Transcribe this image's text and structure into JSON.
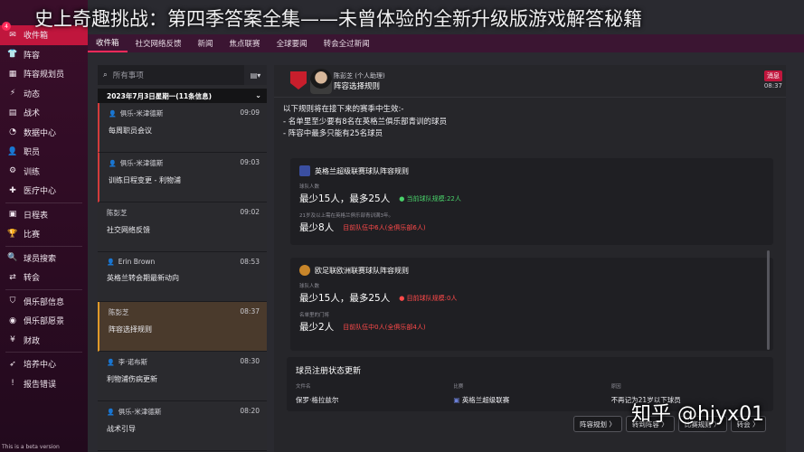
{
  "title_overlay": "史上奇趣挑战：第四季答案全集——未曾体验的全新升级版游戏解答秘籍",
  "watermark": "知乎 @hjyx01",
  "beta": "This is a beta version",
  "sidebar": {
    "notif_count": "4",
    "items": [
      {
        "label": "收件箱",
        "icon": "✉"
      },
      {
        "label": "阵容",
        "icon": "👕"
      },
      {
        "label": "阵容规划员",
        "icon": "▦"
      },
      {
        "label": "动态",
        "icon": "⚡"
      },
      {
        "label": "战术",
        "icon": "▤"
      },
      {
        "label": "数据中心",
        "icon": "◔"
      },
      {
        "label": "职员",
        "icon": "👤"
      },
      {
        "label": "训练",
        "icon": "⚙"
      },
      {
        "label": "医疗中心",
        "icon": "✚"
      },
      {
        "label": "日程表",
        "icon": "▣"
      },
      {
        "label": "比赛",
        "icon": "🏆"
      },
      {
        "label": "球员搜索",
        "icon": "🔍"
      },
      {
        "label": "转会",
        "icon": "⇄"
      },
      {
        "label": "俱乐部信息",
        "icon": "⛉"
      },
      {
        "label": "俱乐部愿景",
        "icon": "◉"
      },
      {
        "label": "财政",
        "icon": "¥"
      },
      {
        "label": "培养中心",
        "icon": "➶"
      },
      {
        "label": "报告错误",
        "icon": "!"
      }
    ]
  },
  "tabs": [
    "收件箱",
    "社交网络反馈",
    "新闻",
    "焦点联赛",
    "全球要闻",
    "转会全过新闻"
  ],
  "inbox": {
    "search_placeholder": "所有事项",
    "date_header": "2023年7月3日星期一(11条信息)",
    "messages": [
      {
        "sender": "俱乐-米津德斯",
        "time": "09:09",
        "subject": "每周职员会议"
      },
      {
        "sender": "俱乐-米津德斯",
        "time": "09:03",
        "subject": "训练日程变更 - 利物浦"
      },
      {
        "sender": "陈彭芝",
        "time": "09:02",
        "subject": "社交网络反馈"
      },
      {
        "sender": "Erin Brown",
        "time": "08:53",
        "subject": "英格兰转会期最新动向"
      },
      {
        "sender": "陈彭芝",
        "time": "08:37",
        "subject": "阵容选择规则"
      },
      {
        "sender": "李·诺布斯",
        "time": "08:30",
        "subject": "利物浦伤病更新"
      },
      {
        "sender": "俱乐-米津德斯",
        "time": "08:20",
        "subject": "战术引导"
      }
    ]
  },
  "message": {
    "sender": "陈彭芝 (个人助理)",
    "subject": "阵容选择规则",
    "tag": "消息",
    "time": "08:37",
    "intro": "以下规则将在接下来的赛季中生效:-",
    "rule1": "- 名单里至少要有8名在英格兰俱乐部青训的球员",
    "rule2": "- 阵容中最多只能有25名球员",
    "card1": {
      "title": "英格兰超级联赛球队阵容规则",
      "label1": "球队人数",
      "min1": "最少15人，",
      "max1": "最多25人",
      "status1": "● 当前球队规模:22人",
      "label2": "21岁及以上需在英格兰俱乐部青训满3年。",
      "min2": "最少8人",
      "status2": "目前队伍中6人(全俱乐部6人)"
    },
    "card2": {
      "title": "欧足联欧洲联赛球队阵容规则",
      "label1": "球队人数",
      "min1": "最少15人，",
      "max1": "最多25人",
      "status1": "● 目前球队规模:0人",
      "label2": "名单里的门将",
      "min2": "最少2人",
      "status2": "目前队伍中0人(全俱乐部4人)"
    },
    "reg": {
      "title": "球员注册状态更新",
      "col1": "文件名",
      "col2": "比赛",
      "col3": "原因",
      "val1": "保罗·格拉兹尔",
      "val2": "英格兰超级联赛",
      "val3": "不再记为21岁以下球员"
    },
    "actions": [
      "阵容规划 〉",
      "转到阵容 〉",
      "比赛规则 〉",
      "转会 〉"
    ]
  }
}
